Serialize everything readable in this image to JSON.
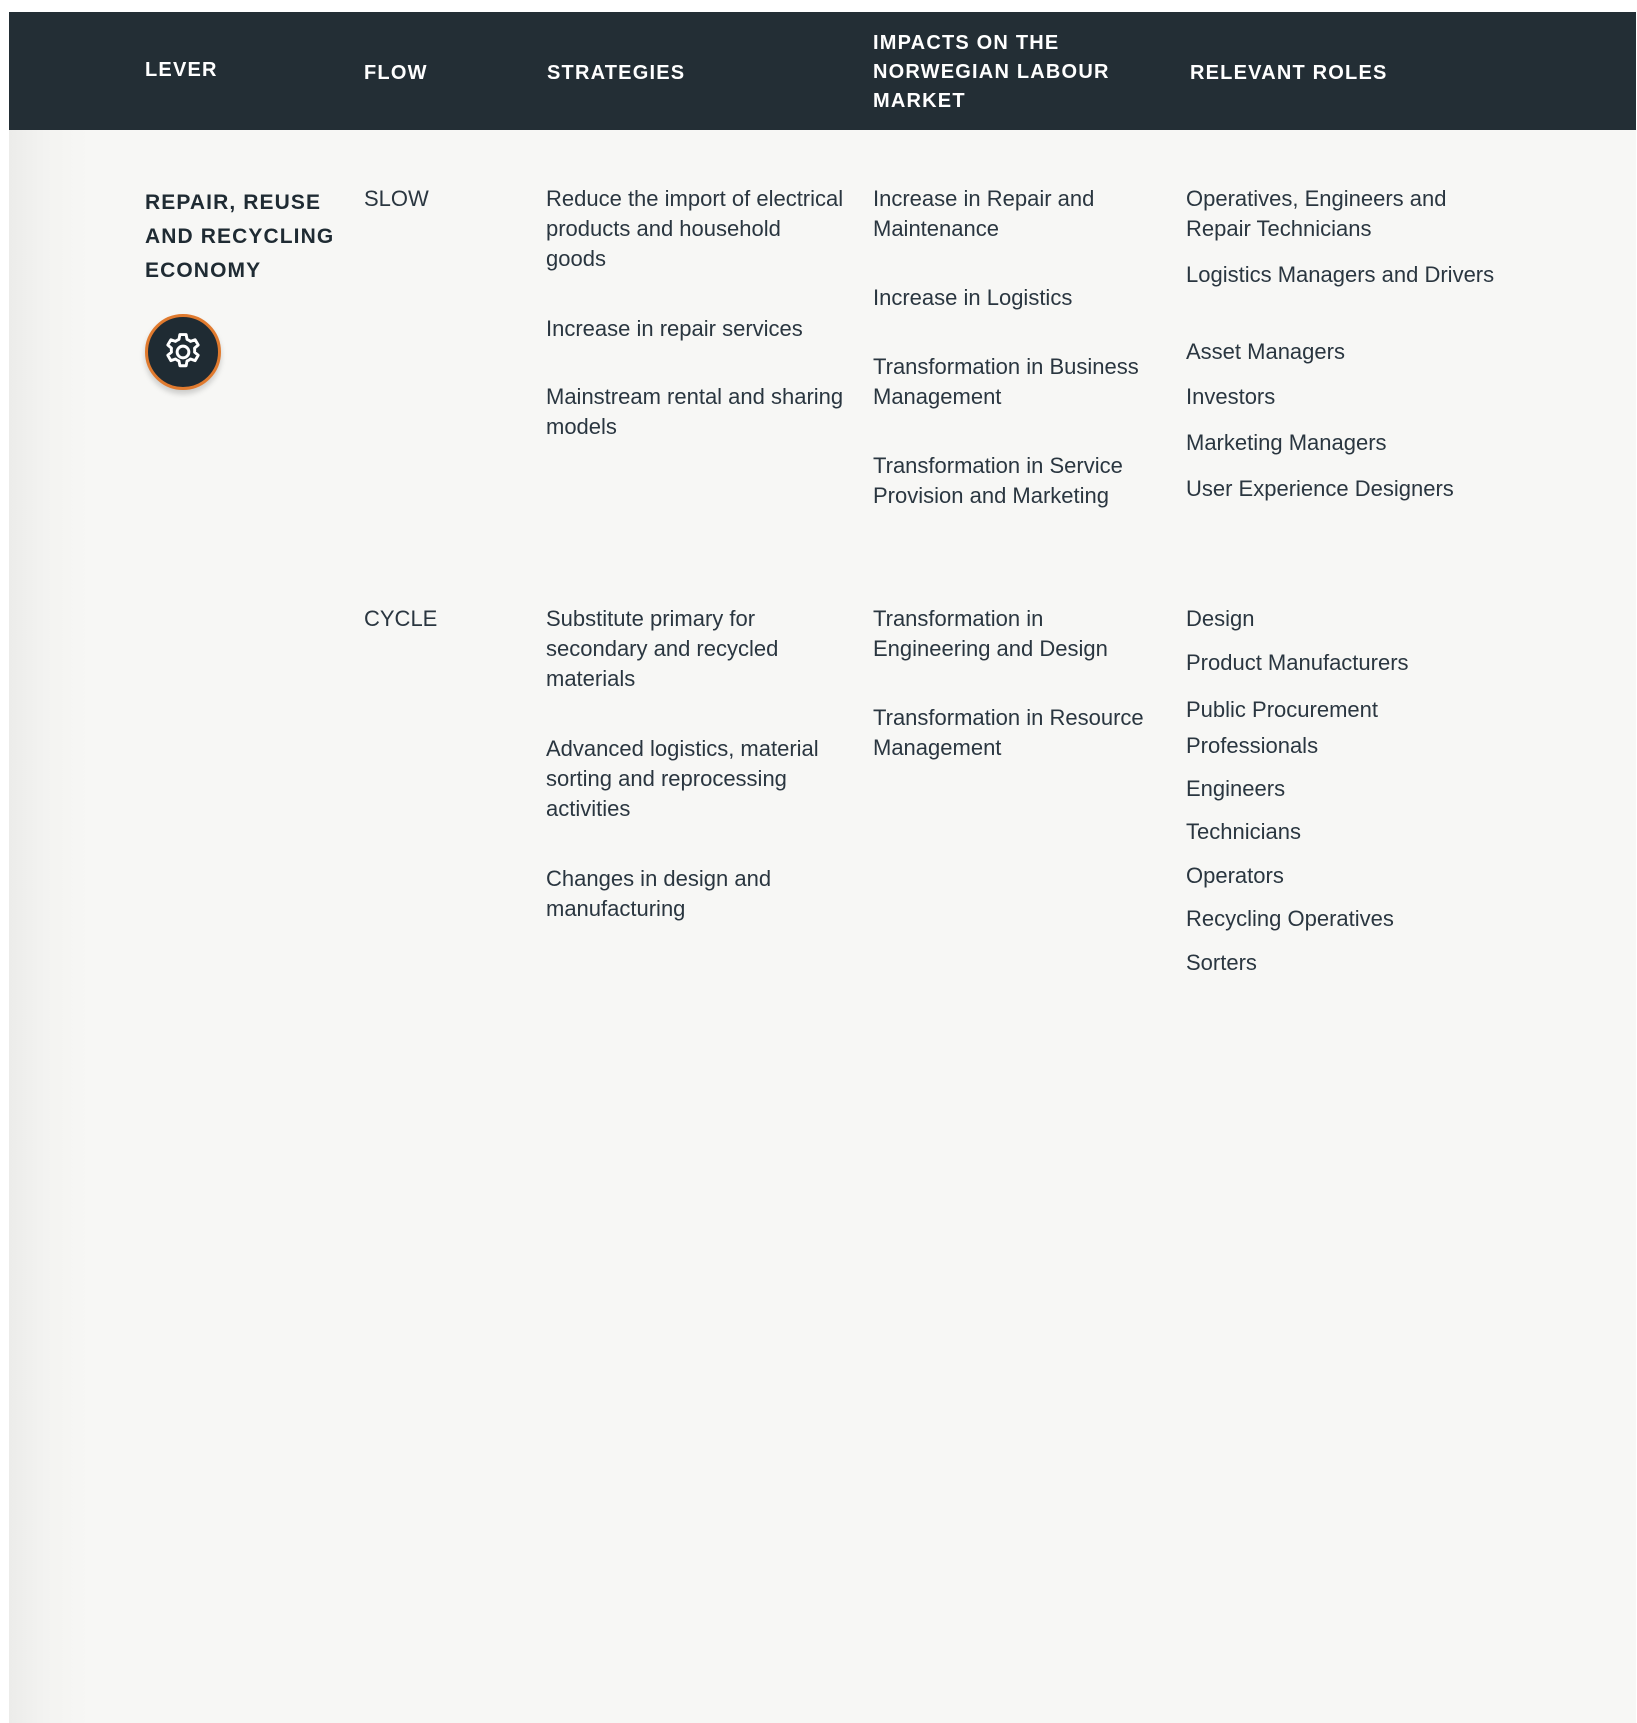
{
  "header": {
    "lever": "LEVER",
    "flow": "FLOW",
    "strategies": "STRATEGIES",
    "impacts": "IMPACTS ON THE\nNORWEGIAN LABOUR\nMARKET",
    "roles": "RELEVANT ROLES"
  },
  "lever": {
    "title": "REPAIR, REUSE\nAND RECYCLING\nECONOMY",
    "icon": "gear-icon",
    "colors": {
      "badge": "#1f2b33",
      "ring": "#e07a2e"
    }
  },
  "rows": [
    {
      "flow": "SLOW",
      "strategies": [
        "Reduce the import of electrical products and household goods",
        "Increase in repair services",
        "Mainstream rental and sharing models"
      ],
      "impacts": [
        "Increase in Repair and Maintenance",
        "Increase in Logistics",
        "Transformation in Business Management",
        "Transformation in Service Provision and Marketing"
      ],
      "roles": [
        "Operatives, Engineers and Repair Technicians",
        "Logistics Managers and Drivers",
        "Asset Managers",
        "Investors",
        "Marketing Managers",
        "User Experience Designers"
      ]
    },
    {
      "flow": "CYCLE",
      "strategies": [
        "Substitute primary for secondary and recycled materials",
        "Advanced logistics, material sorting and reprocessing activities",
        "Changes in design and manufacturing"
      ],
      "impacts": [
        "Transformation in Engineering and Design",
        "Transformation in Resource Management"
      ],
      "roles": [
        "Design",
        "Product Manufacturers",
        "Public Procurement Professionals",
        "Engineers",
        "Technicians",
        "Operators",
        "Recycling Operatives",
        "Sorters"
      ]
    }
  ]
}
